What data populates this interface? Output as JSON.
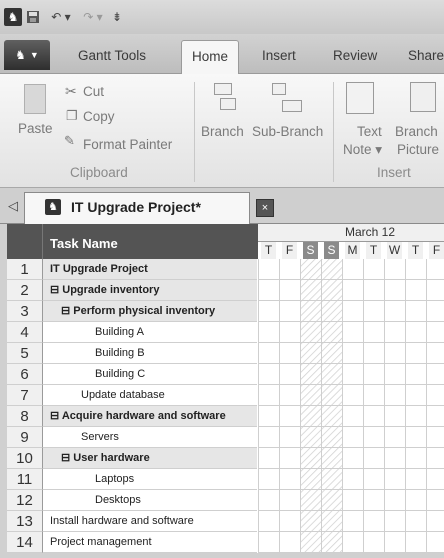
{
  "ribbon_tabs": [
    {
      "label": "Gantt Tools"
    },
    {
      "label": "Home"
    },
    {
      "label": "Insert"
    },
    {
      "label": "Review"
    },
    {
      "label": "Share"
    }
  ],
  "clipboard": {
    "paste": "Paste",
    "cut": "Cut",
    "copy": "Copy",
    "format_painter": "Format Painter",
    "group_label": "Clipboard"
  },
  "branch": {
    "branch": "Branch",
    "sub_branch": "Sub-Branch"
  },
  "insert": {
    "text_note_1": "Text",
    "text_note_2": "Note ▾",
    "branch_picture_1": "Branch",
    "branch_picture_2": "Picture",
    "group_label": "Insert"
  },
  "document": {
    "title": "IT Upgrade Project*",
    "close": "×"
  },
  "grid": {
    "task_header": "Task Name",
    "timeline_month": "March 12",
    "days": [
      "T",
      "F",
      "S",
      "S",
      "M",
      "T",
      "W",
      "T",
      "F"
    ],
    "rows": [
      {
        "num": "1",
        "name": "IT Upgrade Project"
      },
      {
        "num": "2",
        "name": "⊟ Upgrade inventory"
      },
      {
        "num": "3",
        "name": "⊟ Perform physical inventory"
      },
      {
        "num": "4",
        "name": "Building A"
      },
      {
        "num": "5",
        "name": "Building B"
      },
      {
        "num": "6",
        "name": "Building C"
      },
      {
        "num": "7",
        "name": "Update database"
      },
      {
        "num": "8",
        "name": "⊟ Acquire hardware and software"
      },
      {
        "num": "9",
        "name": "Servers"
      },
      {
        "num": "10",
        "name": "⊟ User hardware"
      },
      {
        "num": "11",
        "name": "Laptops"
      },
      {
        "num": "12",
        "name": "Desktops"
      },
      {
        "num": "13",
        "name": "Install hardware and software"
      },
      {
        "num": "14",
        "name": "Project management"
      }
    ]
  }
}
